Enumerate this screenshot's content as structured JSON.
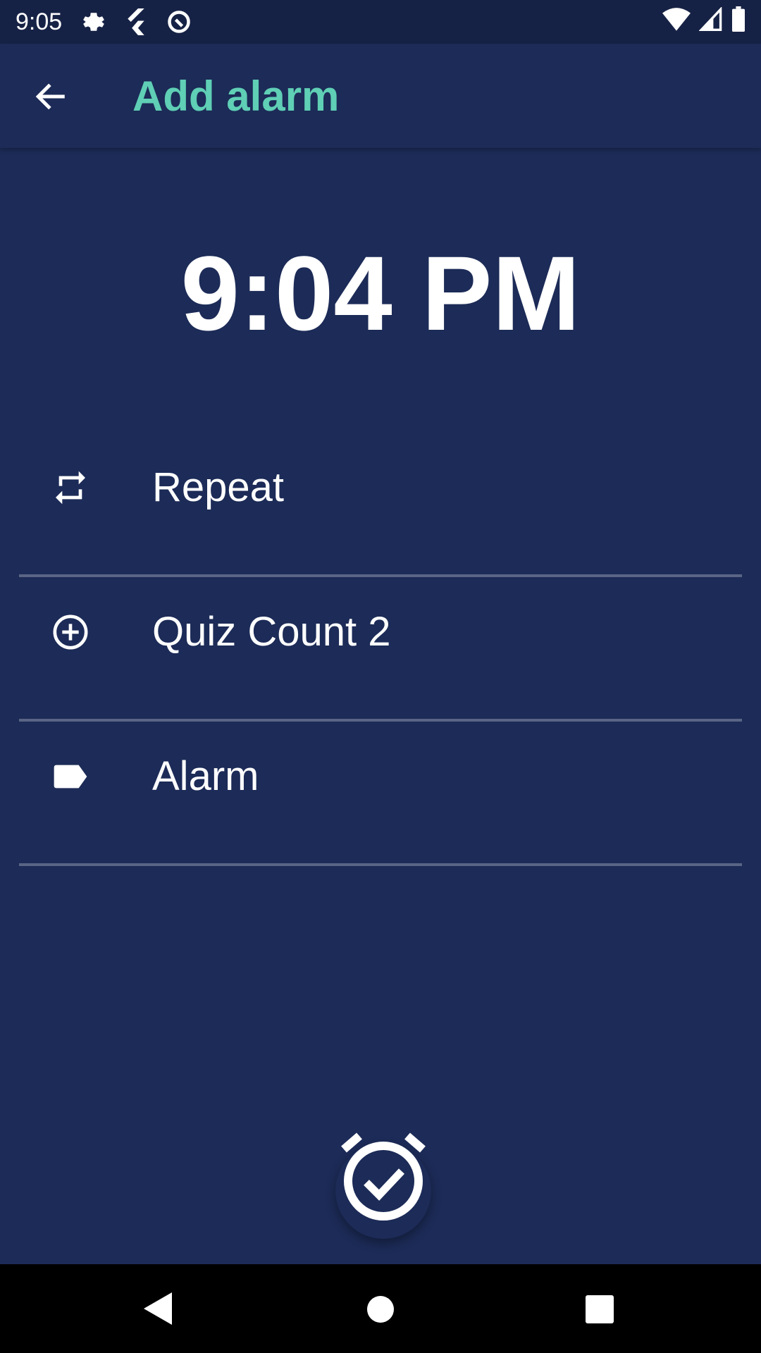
{
  "status_bar": {
    "time": "9:05",
    "icons": [
      "gear-icon",
      "flutter-icon",
      "debug-icon",
      "wifi-icon",
      "signal-icon",
      "battery-icon"
    ]
  },
  "app_bar": {
    "title": "Add alarm",
    "back_icon": "arrow-back-icon"
  },
  "alarm_time": "9:04 PM",
  "options": [
    {
      "icon": "repeat-icon",
      "label": "Repeat"
    },
    {
      "icon": "add-circle-icon",
      "label": "Quiz Count 2"
    },
    {
      "icon": "label-icon",
      "label": "Alarm"
    }
  ],
  "fab": {
    "icon": "alarm-check-icon"
  },
  "colors": {
    "background": "#1c2b57",
    "accent": "#5fcfb5",
    "status_bar": "#162245"
  }
}
